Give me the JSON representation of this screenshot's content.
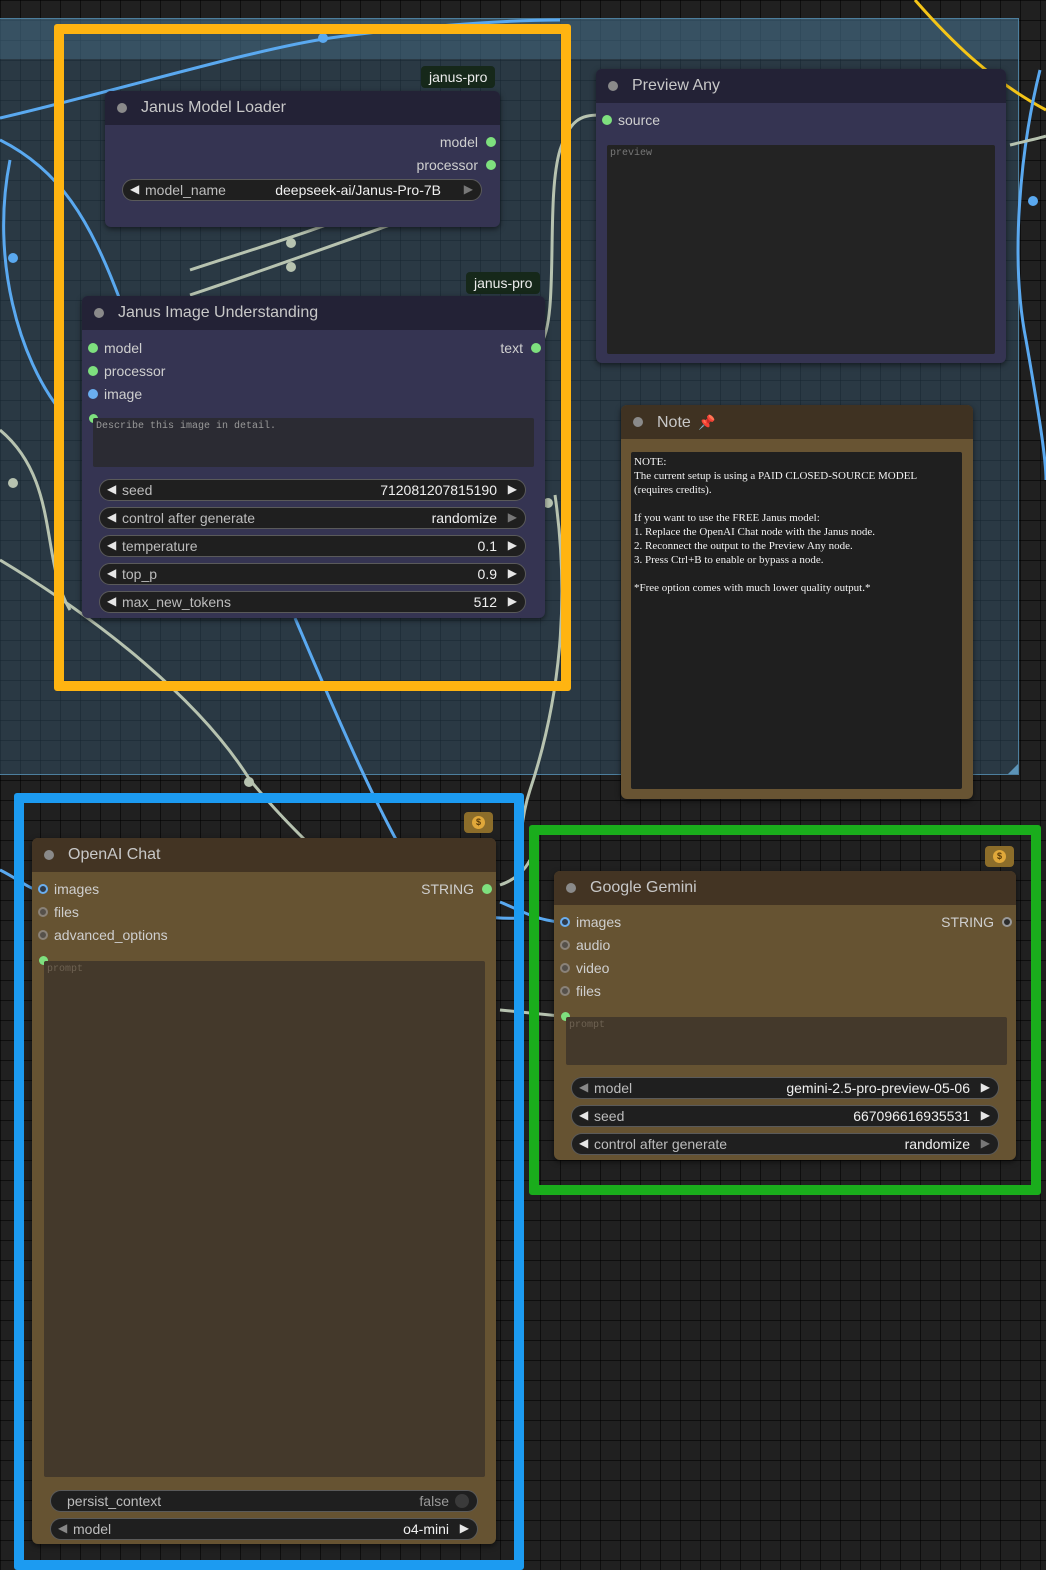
{
  "nodes": {
    "janus_model_loader": {
      "title": "Janus Model Loader",
      "badge": "janus-pro",
      "outputs": [
        "model",
        "processor"
      ],
      "widgets": {
        "model_name": {
          "label": "model_name",
          "value": "deepseek-ai/Janus-Pro-7B"
        }
      }
    },
    "janus_image_understanding": {
      "title": "Janus Image Understanding",
      "badge": "janus-pro",
      "inputs": [
        "model",
        "processor",
        "image"
      ],
      "output": "text",
      "prompt": "Describe this image in detail.",
      "widgets": [
        {
          "label": "seed",
          "value": "712081207815190"
        },
        {
          "label": "control after generate",
          "value": "randomize"
        },
        {
          "label": "temperature",
          "value": "0.1"
        },
        {
          "label": "top_p",
          "value": "0.9"
        },
        {
          "label": "max_new_tokens",
          "value": "512"
        }
      ]
    },
    "preview_any": {
      "title": "Preview Any",
      "input": "source",
      "placeholder": "preview"
    },
    "note": {
      "title": "Note",
      "pin_icon": "pushpin-icon",
      "text": "NOTE:\nThe current setup is using a PAID CLOSED-SOURCE MODEL\n(requires credits).\n\nIf you want to use the FREE Janus model:\n1. Replace the OpenAI Chat node with the Janus node.\n2. Reconnect the output to the Preview Any node.\n3. Press Ctrl+B to enable or bypass a node.\n\n*Free option comes with much lower quality output.*"
    },
    "openai_chat": {
      "title": "OpenAI Chat",
      "inputs": [
        "images",
        "files",
        "advanced_options"
      ],
      "output": "STRING",
      "placeholder": "prompt",
      "widgets": [
        {
          "label": "persist_context",
          "value": "false"
        },
        {
          "label": "model",
          "value": "o4-mini"
        }
      ],
      "credit_icon": "coin-icon"
    },
    "google_gemini": {
      "title": "Google Gemini",
      "inputs": [
        "images",
        "audio",
        "video",
        "files"
      ],
      "output": "STRING",
      "placeholder": "prompt",
      "widgets": [
        {
          "label": "model",
          "value": "gemini-2.5-pro-preview-05-06"
        },
        {
          "label": "seed",
          "value": "667096616935531"
        },
        {
          "label": "control after generate",
          "value": "randomize"
        }
      ],
      "credit_icon": "coin-icon"
    }
  },
  "colors": {
    "highlight_yellow": "#ffb411",
    "highlight_blue": "#1c9bf1",
    "highlight_green": "#1aad1c",
    "link_blue": "#5aa9f0",
    "link_gray": "#b7c3b0",
    "link_yellow": "#f5c518"
  }
}
